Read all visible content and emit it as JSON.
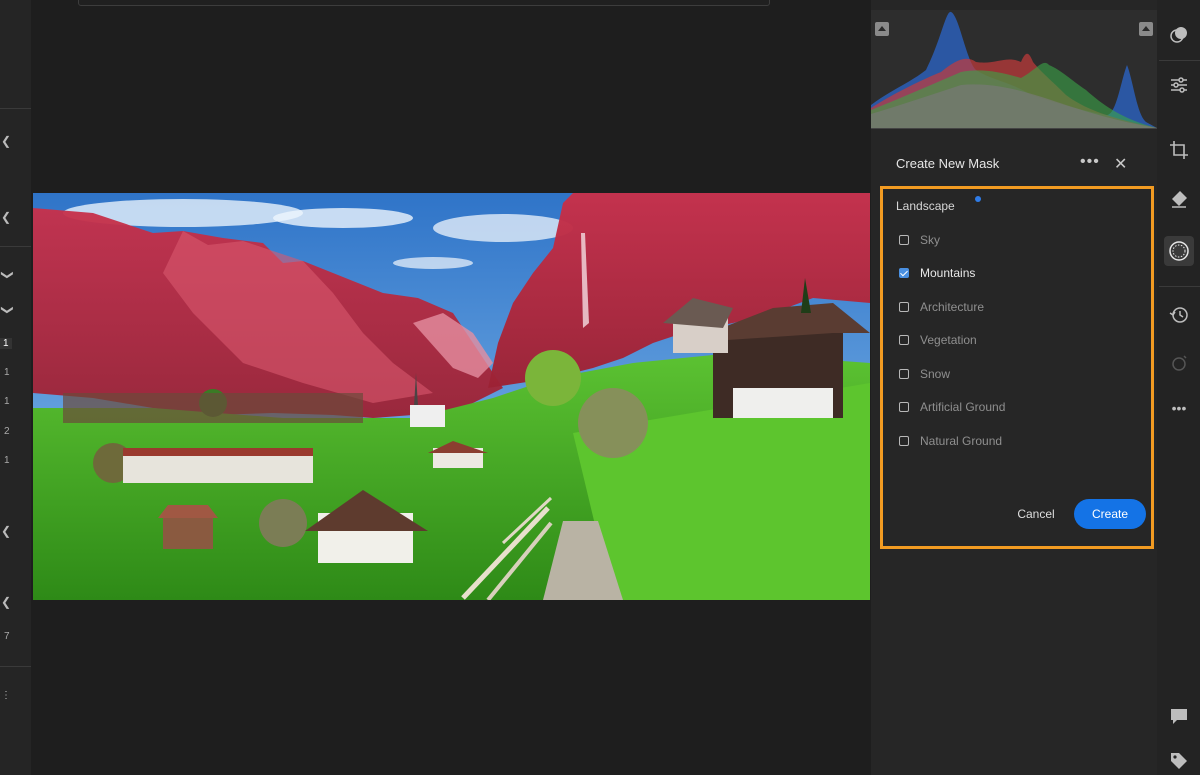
{
  "left_strip": {
    "numbers": [
      "1",
      "1",
      "1",
      "2",
      "1",
      "7"
    ]
  },
  "mask_panel": {
    "title": "Create New Mask",
    "section_label": "Landscape",
    "options": [
      {
        "label": "Sky",
        "checked": false
      },
      {
        "label": "Mountains",
        "checked": true
      },
      {
        "label": "Architecture",
        "checked": false
      },
      {
        "label": "Vegetation",
        "checked": false
      },
      {
        "label": "Snow",
        "checked": false
      },
      {
        "label": "Artificial Ground",
        "checked": false
      },
      {
        "label": "Natural Ground",
        "checked": false
      }
    ],
    "cancel_label": "Cancel",
    "create_label": "Create",
    "highlight_color": "#f29b22",
    "accent_color": "#1473e6"
  },
  "icons": {
    "more": "more-horizontal-icon",
    "close": "close-icon",
    "tools": [
      "edit-icon",
      "adjust-sliders-icon",
      "crop-icon",
      "healing-eraser-icon",
      "masking-icon",
      "history-icon",
      "versions-icon",
      "more-icon",
      "comment-icon",
      "tag-icon"
    ]
  }
}
